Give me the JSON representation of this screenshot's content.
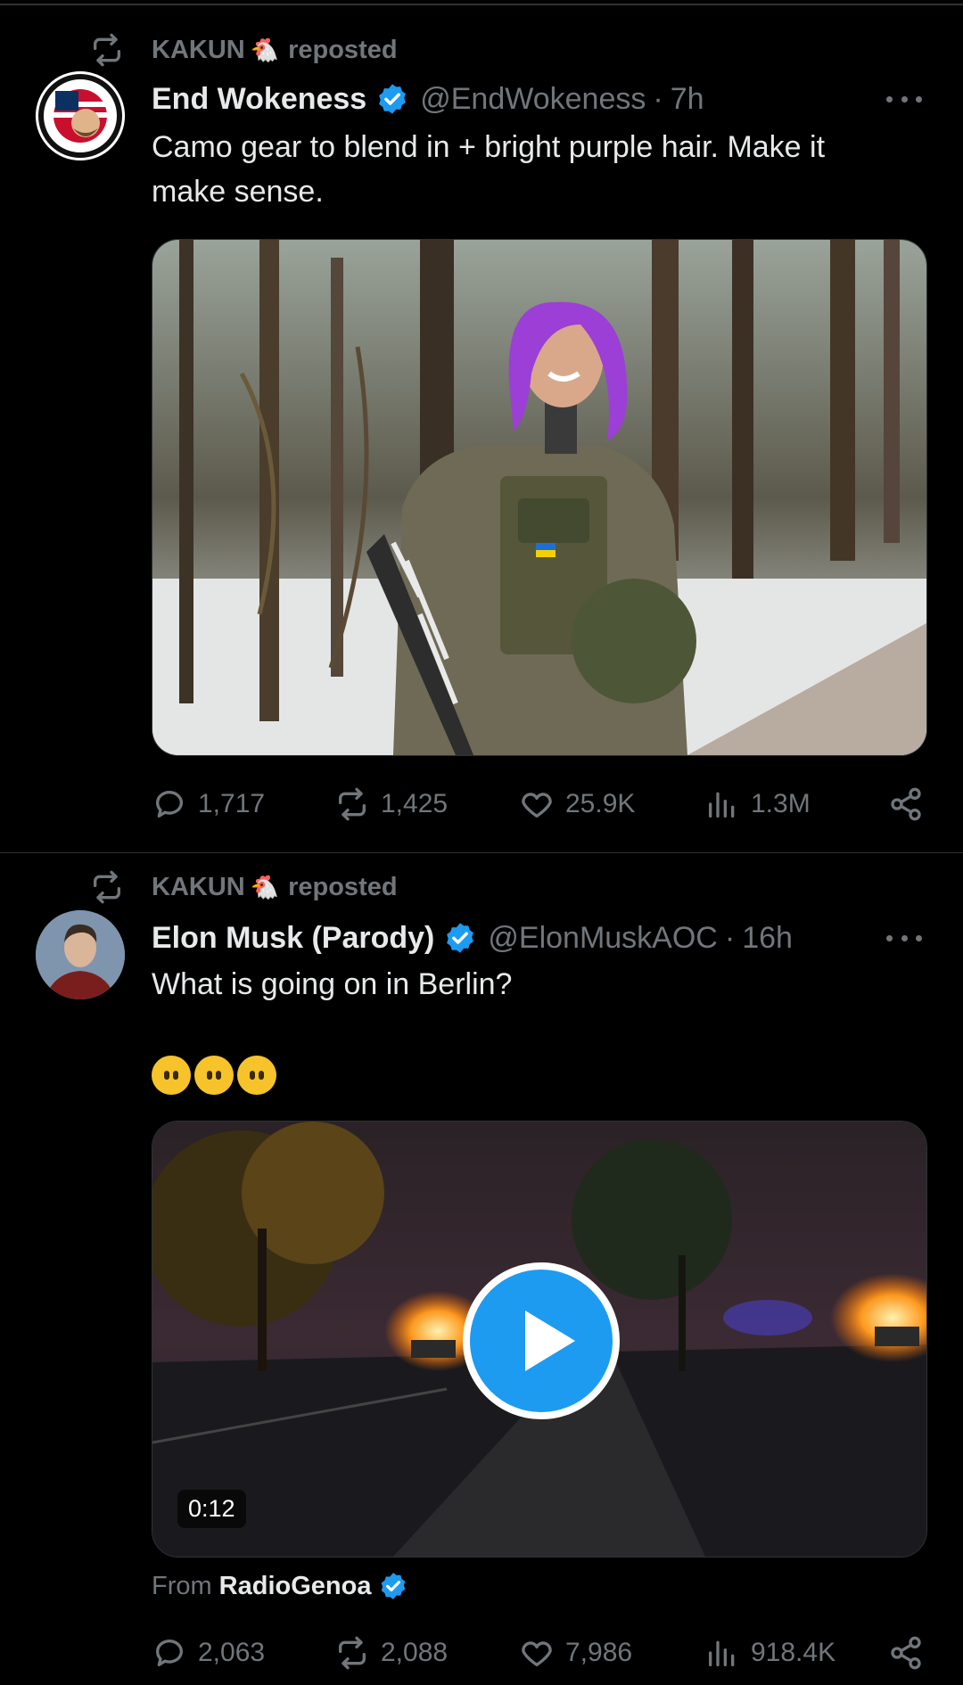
{
  "colors": {
    "background": "#000000",
    "text_primary": "#e7e9ea",
    "text_secondary": "#71767b",
    "verified_blue": "#1d9bf0",
    "divider": "#2f3336"
  },
  "tweets": [
    {
      "repost": {
        "user": "KAKUN",
        "user_emoji": "🐔",
        "label": "reposted"
      },
      "author": {
        "name": "End Wokeness",
        "handle": "@EndWokeness",
        "sep": "·",
        "time": "7h",
        "verified": true,
        "avatar_icon": "seal-avatar"
      },
      "text_lines": [
        "Camo gear to blend in + bright purple hair. Make it",
        "make sense."
      ],
      "media": {
        "kind": "photo",
        "icon": "soldier-in-forest-photo"
      },
      "stats": {
        "replies": "1,717",
        "reposts": "1,425",
        "likes": "25.9K",
        "views": "1.3M"
      }
    },
    {
      "repost": {
        "user": "KAKUN",
        "user_emoji": "🐔",
        "label": "reposted"
      },
      "author": {
        "name": "Elon Musk (Parody)",
        "handle": "@ElonMuskAOC",
        "sep": "·",
        "time": "16h",
        "verified": true,
        "avatar_icon": "portrait-avatar"
      },
      "text_lines": [
        "What is going on in Berlin?"
      ],
      "emoji_line": "😶😶😶",
      "media": {
        "kind": "video",
        "duration": "0:12",
        "icon": "burning-cars-street-video"
      },
      "from": {
        "label": "From",
        "source": "RadioGenoa",
        "verified": true
      },
      "stats": {
        "replies": "2,063",
        "reposts": "2,088",
        "likes": "7,986",
        "views": "918.4K"
      }
    }
  ]
}
